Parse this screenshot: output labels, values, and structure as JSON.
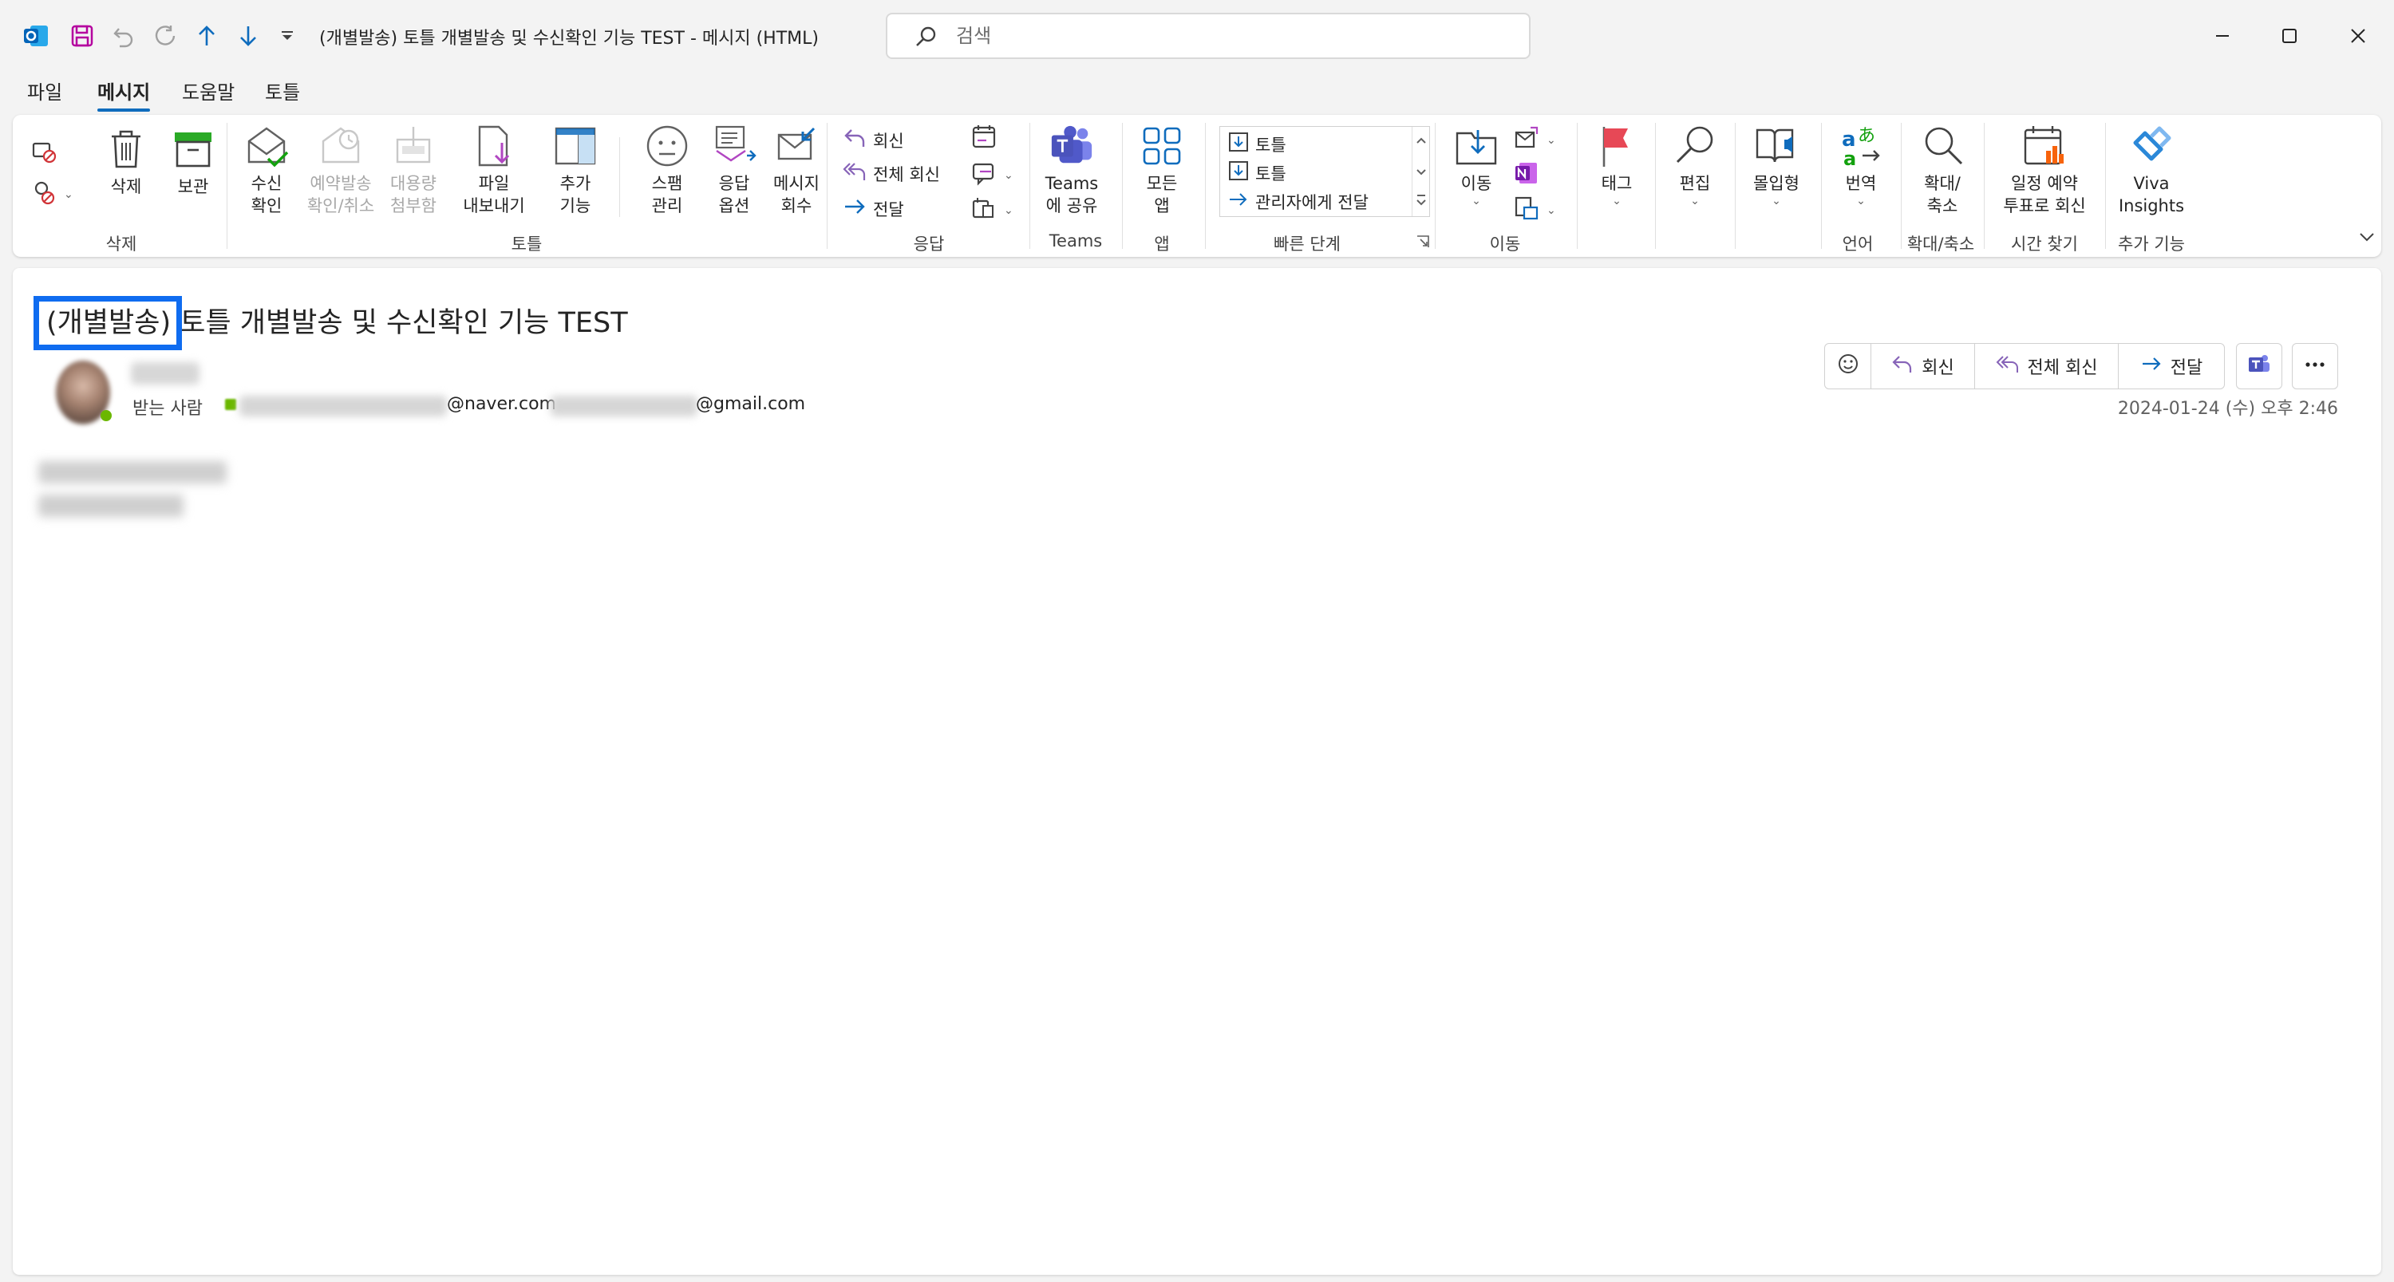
{
  "window": {
    "title": "(개별발송) 토틀 개별발송 및 수신확인 기능 TEST  -  메시지 (HTML)",
    "search_placeholder": "검색"
  },
  "menu_tabs": [
    "파일",
    "메시지",
    "도움말",
    "토틀"
  ],
  "ribbon": {
    "delete_group": {
      "label": "삭제",
      "delete": "삭제",
      "archive": "보관"
    },
    "totle_group": {
      "label": "토틀",
      "read_receipt": "수신\n확인",
      "scheduled_cancel": "예약발송\n확인/취소",
      "large_attach": "대용량\n첨부함",
      "file_export": "파일\n내보내기",
      "more_features": "추가\n기능",
      "spam": "스팸\n관리",
      "reply_options": "응답\n옵션",
      "recall": "메시지\n회수"
    },
    "respond_group": {
      "label": "응답",
      "reply": "회신",
      "reply_all": "전체 회신",
      "forward": "전달"
    },
    "teams_group": {
      "label": "Teams",
      "share": "Teams\n에 공유"
    },
    "apps_group": {
      "label": "앱",
      "all_apps": "모든\n앱"
    },
    "quick_steps": {
      "label": "빠른 단계",
      "items": [
        "토틀",
        "토틀",
        "관리자에게 전달"
      ]
    },
    "move_group": {
      "label": "이동",
      "move": "이동"
    },
    "tags_group": {
      "tag": "태그"
    },
    "edit_group": {
      "edit": "편집"
    },
    "immersive": {
      "label": "몰입형"
    },
    "language_group": {
      "label": "언어",
      "translate": "번역"
    },
    "zoom_group": {
      "label": "확대/축소",
      "zoom": "확대/\n축소"
    },
    "find_time_group": {
      "label": "시간 찾기",
      "schedule_poll": "일정 예약\n투표로 회신"
    },
    "addins_group": {
      "label": "추가 기능",
      "viva": "Viva\nInsights"
    }
  },
  "message": {
    "subject_tag": "(개별발송)",
    "subject_rest": " 토틀 개별발송 및 수신확인 기능 TEST",
    "to_label": "받는 사람",
    "recipient_1_domain": "@naver.com",
    "recipient_2_domain": "@gmail.com",
    "date": "2024-01-24 (수) 오후 2:46",
    "actions": {
      "reply": "회신",
      "reply_all": "전체 회신",
      "forward": "전달"
    }
  },
  "colors": {
    "accent": "#0f6cbd",
    "highlight_box": "#0f6cf0",
    "outlook_blue": "#0364b8",
    "reply_purple": "#8764b8",
    "flag_red": "#e74856"
  },
  "icons": [
    "outlook-icon",
    "save-icon",
    "undo-icon",
    "redo-icon",
    "up-arrow-icon",
    "down-arrow-icon",
    "customize-icon",
    "search-icon",
    "minimize-icon",
    "maximize-icon",
    "close-icon"
  ]
}
